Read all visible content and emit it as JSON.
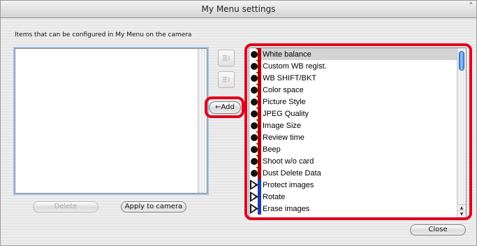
{
  "window": {
    "title": "My Menu settings",
    "caption": "Items that can be configured in My Menu on the camera"
  },
  "buttons": {
    "delete": "Delete",
    "apply": "Apply to camera",
    "add": "←Add",
    "close": "Close"
  },
  "items": [
    {
      "label": "White balance",
      "icon": "red-camera-menu-icon",
      "selected": true
    },
    {
      "label": "Custom WB regist.",
      "icon": "red-camera-menu-icon"
    },
    {
      "label": "WB SHIFT/BKT",
      "icon": "red-camera-menu-icon"
    },
    {
      "label": "Color space",
      "icon": "red-camera-menu-icon"
    },
    {
      "label": "Picture Style",
      "icon": "red-camera-menu-icon"
    },
    {
      "label": "JPEG Quality",
      "icon": "red-camera-menu-icon"
    },
    {
      "label": "Image Size",
      "icon": "red-camera-menu-icon"
    },
    {
      "label": "Review time",
      "icon": "red-camera-menu-icon"
    },
    {
      "label": "Beep",
      "icon": "red-camera-menu-icon"
    },
    {
      "label": "Shoot w/o card",
      "icon": "red-camera-menu-icon"
    },
    {
      "label": "Dust Delete Data",
      "icon": "red-camera-menu-icon"
    },
    {
      "label": "Protect images",
      "icon": "blue-playback-menu-icon"
    },
    {
      "label": "Rotate",
      "icon": "blue-playback-menu-icon"
    },
    {
      "label": "Erase images",
      "icon": "blue-playback-menu-icon"
    }
  ],
  "colors": {
    "highlight": "#e0001b",
    "shooting_menu": "#b40000",
    "playback_menu": "#1b3fa8",
    "selection": "#d4d4d4"
  }
}
